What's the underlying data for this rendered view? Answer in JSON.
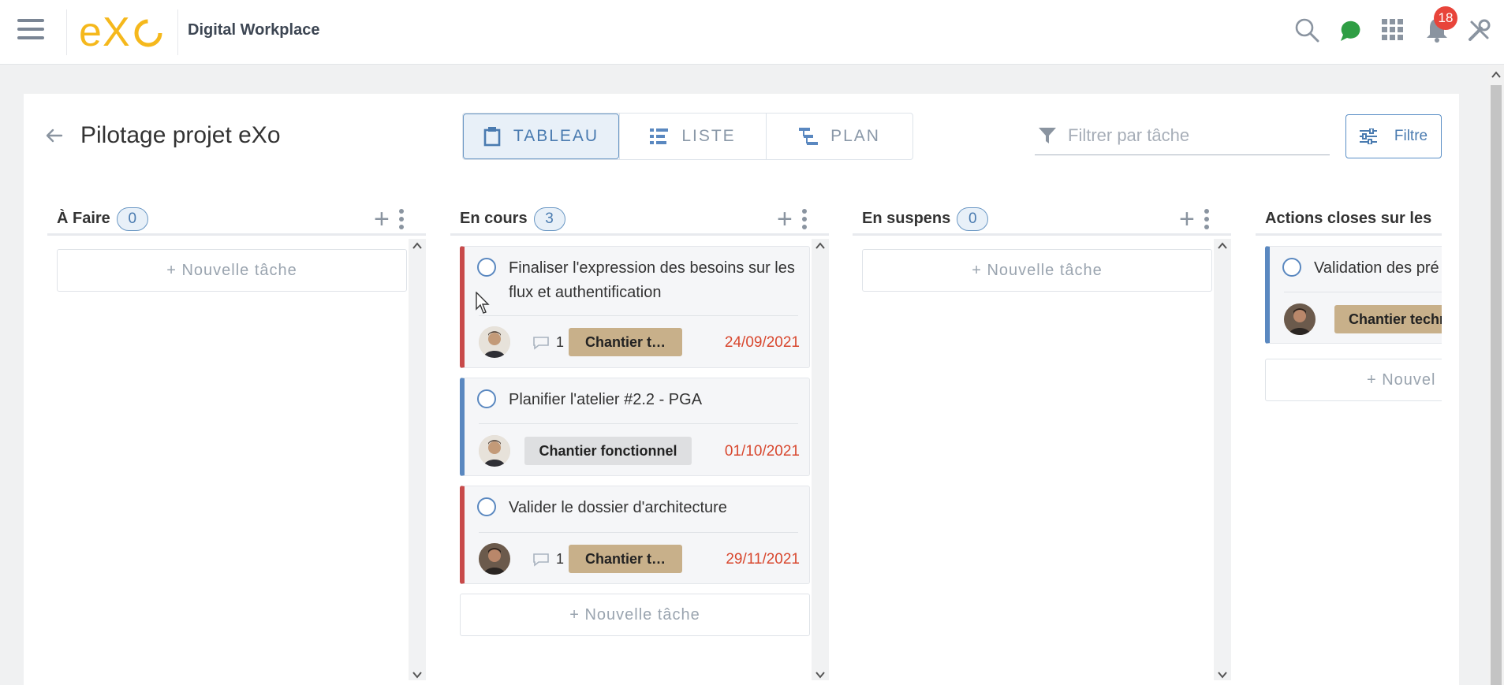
{
  "topbar": {
    "brand": "Digital Workplace",
    "notifications_count": "18",
    "colors": {
      "logo_yellow": "#f5b81c",
      "chat_green": "#2f9e44",
      "badge_red": "#e8443a"
    },
    "icons": [
      "menu-icon",
      "search-icon",
      "chat-icon",
      "apps-icon",
      "bell-icon",
      "admin-tools-icon"
    ]
  },
  "project": {
    "title": "Pilotage projet eXo",
    "views": [
      {
        "label": "TABLEAU",
        "icon": "clipboard-icon",
        "active": true
      },
      {
        "label": "LISTE",
        "icon": "list-icon",
        "active": false
      },
      {
        "label": "PLAN",
        "icon": "gantt-icon",
        "active": false
      }
    ],
    "filter_placeholder": "Filtrer par tâche",
    "filter_button": "Filtre"
  },
  "columns": [
    {
      "title": "À Faire",
      "count": "0",
      "new_task": "+ Nouvelle tâche",
      "tasks": []
    },
    {
      "title": "En cours",
      "count": "3",
      "new_task": "+ Nouvelle tâche",
      "tasks": [
        {
          "title": "Finaliser l'expression des besoins sur les flux et authentification",
          "priority": "red",
          "comments": "1",
          "label": "Chantier t…",
          "label_color": "#c8b08a",
          "due": "24/09/2021"
        },
        {
          "title": "Planifier l'atelier #2.2 - PGA",
          "priority": "blue",
          "comments": "",
          "label": "Chantier fonctionnel",
          "label_color": "#dedfe1",
          "due": "01/10/2021"
        },
        {
          "title": "Valider le dossier d'architecture",
          "priority": "red",
          "comments": "1",
          "label": "Chantier t…",
          "label_color": "#c8b08a",
          "due": "29/11/2021"
        }
      ]
    },
    {
      "title": "En suspens",
      "count": "0",
      "new_task": "+ Nouvelle tâche",
      "tasks": []
    },
    {
      "title": "Actions closes sur les",
      "new_task": "+ Nouvel",
      "tasks": [
        {
          "title": "Validation des pré",
          "priority": "blue",
          "label": "Chantier techn"
        }
      ]
    }
  ]
}
